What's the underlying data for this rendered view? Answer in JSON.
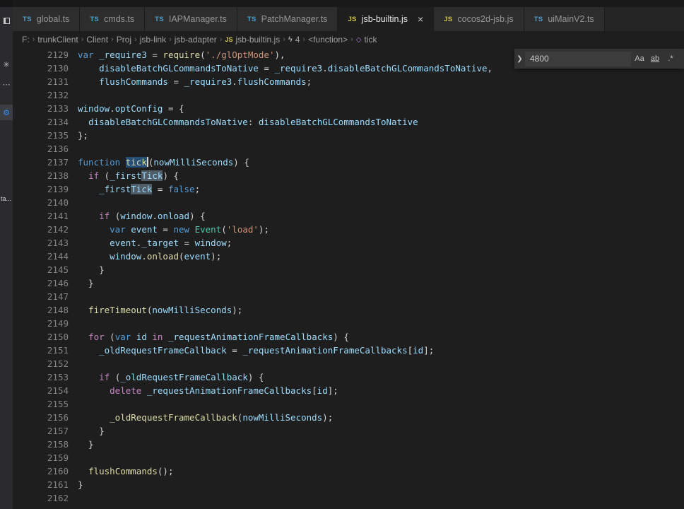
{
  "theme": {
    "accent": "#3794ff",
    "editor_bg": "#1e1e1e",
    "tabbar_bg": "#252526",
    "tab_inactive_bg": "#2d2d2d",
    "activity_bar_bg": "#2b2b2e",
    "kw": "#569CD6",
    "ctl": "#C586C0",
    "v": "#9CDCFE",
    "fn": "#DCDCAA",
    "s": "#CE9178",
    "cls": "#4EC9B0",
    "pl": "#D4D4D4",
    "line_number": "#858585",
    "selection": "#264F78",
    "occurrence": "#505c66",
    "ts_icon": "#4e9fd1",
    "js_icon": "#d4c64e"
  },
  "activity_bar": {
    "truncated_label": "ta..."
  },
  "tabs": [
    {
      "label": "global.ts",
      "file_type": "TS",
      "active": false
    },
    {
      "label": "cmds.ts",
      "file_type": "TS",
      "active": false
    },
    {
      "label": "IAPManager.ts",
      "file_type": "TS",
      "active": false
    },
    {
      "label": "PatchManager.ts",
      "file_type": "TS",
      "active": false
    },
    {
      "label": "jsb-builtin.js",
      "file_type": "JS",
      "active": true,
      "close": "×"
    },
    {
      "label": "cocos2d-jsb.js",
      "file_type": "JS",
      "active": false
    },
    {
      "label": "uiMainV2.ts",
      "file_type": "TS",
      "active": false
    }
  ],
  "breadcrumbs": [
    {
      "label": "F:"
    },
    {
      "label": "trunkClient"
    },
    {
      "label": "Client"
    },
    {
      "label": "Proj"
    },
    {
      "label": "jsb-link"
    },
    {
      "label": "jsb-adapter"
    },
    {
      "label": "jsb-builtin.js",
      "icon": "JS"
    },
    {
      "label": "4",
      "icon": "event"
    },
    {
      "label": "<function>"
    },
    {
      "label": "tick",
      "icon": "symbol"
    }
  ],
  "find_widget": {
    "toggle_icon": "❯",
    "value": "4800",
    "match_case_label": "Aa",
    "whole_word_label": "ab",
    "regex_label": ".*"
  },
  "editor": {
    "lines": [
      {
        "n": 2129,
        "t": [
          [
            "kw",
            "var"
          ],
          [
            "pl",
            " "
          ],
          [
            "v",
            "_require3"
          ],
          [
            "pl",
            " = "
          ],
          [
            "fn",
            "require"
          ],
          [
            "pl",
            "("
          ],
          [
            "s",
            "'./glOptMode'"
          ],
          [
            "pl",
            "),"
          ]
        ]
      },
      {
        "n": 2130,
        "t": [
          [
            "pl",
            "    "
          ],
          [
            "v",
            "disableBatchGLCommandsToNative"
          ],
          [
            "pl",
            " = "
          ],
          [
            "v",
            "_require3"
          ],
          [
            "pl",
            "."
          ],
          [
            "v",
            "disableBatchGLCommandsToNative"
          ],
          [
            "pl",
            ","
          ]
        ]
      },
      {
        "n": 2131,
        "t": [
          [
            "pl",
            "    "
          ],
          [
            "v",
            "flushCommands"
          ],
          [
            "pl",
            " = "
          ],
          [
            "v",
            "_require3"
          ],
          [
            "pl",
            "."
          ],
          [
            "v",
            "flushCommands"
          ],
          [
            "pl",
            ";"
          ]
        ]
      },
      {
        "n": 2132,
        "t": []
      },
      {
        "n": 2133,
        "t": [
          [
            "v",
            "window"
          ],
          [
            "pl",
            "."
          ],
          [
            "v",
            "optConfig"
          ],
          [
            "pl",
            " = {"
          ]
        ]
      },
      {
        "n": 2134,
        "t": [
          [
            "pl",
            "  "
          ],
          [
            "v",
            "disableBatchGLCommandsToNative"
          ],
          [
            "pl",
            ": "
          ],
          [
            "v",
            "disableBatchGLCommandsToNative"
          ]
        ]
      },
      {
        "n": 2135,
        "t": [
          [
            "pl",
            "};"
          ]
        ]
      },
      {
        "n": 2136,
        "t": []
      },
      {
        "n": 2137,
        "t": [
          [
            "kw",
            "function"
          ],
          [
            "pl",
            " "
          ],
          [
            "fn",
            "tick",
            "sel"
          ],
          [
            "caret",
            ""
          ],
          [
            "pl",
            "("
          ],
          [
            "v",
            "nowMilliSeconds"
          ],
          [
            "pl",
            ") {"
          ]
        ]
      },
      {
        "n": 2138,
        "t": [
          [
            "pl",
            "  "
          ],
          [
            "ctl",
            "if"
          ],
          [
            "pl",
            " ("
          ],
          [
            "v",
            "_first"
          ],
          [
            "v",
            "Tick",
            "word"
          ],
          [
            "pl",
            ") {"
          ]
        ]
      },
      {
        "n": 2139,
        "t": [
          [
            "pl",
            "    "
          ],
          [
            "v",
            "_first"
          ],
          [
            "v",
            "Tick",
            "word"
          ],
          [
            "pl",
            " = "
          ],
          [
            "kw",
            "false"
          ],
          [
            "pl",
            ";"
          ]
        ]
      },
      {
        "n": 2140,
        "t": []
      },
      {
        "n": 2141,
        "t": [
          [
            "pl",
            "    "
          ],
          [
            "ctl",
            "if"
          ],
          [
            "pl",
            " ("
          ],
          [
            "v",
            "window"
          ],
          [
            "pl",
            "."
          ],
          [
            "v",
            "onload"
          ],
          [
            "pl",
            ") {"
          ]
        ]
      },
      {
        "n": 2142,
        "t": [
          [
            "pl",
            "      "
          ],
          [
            "kw",
            "var"
          ],
          [
            "pl",
            " "
          ],
          [
            "v",
            "event"
          ],
          [
            "pl",
            " = "
          ],
          [
            "kw",
            "new"
          ],
          [
            "pl",
            " "
          ],
          [
            "cls",
            "Event"
          ],
          [
            "pl",
            "("
          ],
          [
            "s",
            "'load'"
          ],
          [
            "pl",
            ");"
          ]
        ]
      },
      {
        "n": 2143,
        "t": [
          [
            "pl",
            "      "
          ],
          [
            "v",
            "event"
          ],
          [
            "pl",
            "."
          ],
          [
            "v",
            "_target"
          ],
          [
            "pl",
            " = "
          ],
          [
            "v",
            "window"
          ],
          [
            "pl",
            ";"
          ]
        ]
      },
      {
        "n": 2144,
        "t": [
          [
            "pl",
            "      "
          ],
          [
            "v",
            "window"
          ],
          [
            "pl",
            "."
          ],
          [
            "fn",
            "onload"
          ],
          [
            "pl",
            "("
          ],
          [
            "v",
            "event"
          ],
          [
            "pl",
            ");"
          ]
        ]
      },
      {
        "n": 2145,
        "t": [
          [
            "pl",
            "    }"
          ]
        ]
      },
      {
        "n": 2146,
        "t": [
          [
            "pl",
            "  }"
          ]
        ]
      },
      {
        "n": 2147,
        "t": []
      },
      {
        "n": 2148,
        "t": [
          [
            "pl",
            "  "
          ],
          [
            "fn",
            "fireTimeout"
          ],
          [
            "pl",
            "("
          ],
          [
            "v",
            "nowMilliSeconds"
          ],
          [
            "pl",
            ");"
          ]
        ]
      },
      {
        "n": 2149,
        "t": []
      },
      {
        "n": 2150,
        "t": [
          [
            "pl",
            "  "
          ],
          [
            "ctl",
            "for"
          ],
          [
            "pl",
            " ("
          ],
          [
            "kw",
            "var"
          ],
          [
            "pl",
            " "
          ],
          [
            "v",
            "id"
          ],
          [
            "pl",
            " "
          ],
          [
            "ctl",
            "in"
          ],
          [
            "pl",
            " "
          ],
          [
            "v",
            "_requestAnimationFrameCallbacks"
          ],
          [
            "pl",
            ") {"
          ]
        ]
      },
      {
        "n": 2151,
        "t": [
          [
            "pl",
            "    "
          ],
          [
            "v",
            "_oldRequestFrameCallback"
          ],
          [
            "pl",
            " = "
          ],
          [
            "v",
            "_requestAnimationFrameCallbacks"
          ],
          [
            "pl",
            "["
          ],
          [
            "v",
            "id"
          ],
          [
            "pl",
            "];"
          ]
        ]
      },
      {
        "n": 2152,
        "t": []
      },
      {
        "n": 2153,
        "t": [
          [
            "pl",
            "    "
          ],
          [
            "ctl",
            "if"
          ],
          [
            "pl",
            " ("
          ],
          [
            "v",
            "_oldRequestFrameCallback"
          ],
          [
            "pl",
            ") {"
          ]
        ]
      },
      {
        "n": 2154,
        "t": [
          [
            "pl",
            "      "
          ],
          [
            "ctl",
            "delete"
          ],
          [
            "pl",
            " "
          ],
          [
            "v",
            "_requestAnimationFrameCallbacks"
          ],
          [
            "pl",
            "["
          ],
          [
            "v",
            "id"
          ],
          [
            "pl",
            "];"
          ]
        ]
      },
      {
        "n": 2155,
        "t": []
      },
      {
        "n": 2156,
        "t": [
          [
            "pl",
            "      "
          ],
          [
            "fn",
            "_oldRequestFrameCallback"
          ],
          [
            "pl",
            "("
          ],
          [
            "v",
            "nowMilliSeconds"
          ],
          [
            "pl",
            ");"
          ]
        ]
      },
      {
        "n": 2157,
        "t": [
          [
            "pl",
            "    }"
          ]
        ]
      },
      {
        "n": 2158,
        "t": [
          [
            "pl",
            "  }"
          ]
        ]
      },
      {
        "n": 2159,
        "t": []
      },
      {
        "n": 2160,
        "t": [
          [
            "pl",
            "  "
          ],
          [
            "fn",
            "flushCommands"
          ],
          [
            "pl",
            "();"
          ]
        ]
      },
      {
        "n": 2161,
        "t": [
          [
            "pl",
            "}"
          ]
        ]
      },
      {
        "n": 2162,
        "t": []
      }
    ]
  }
}
